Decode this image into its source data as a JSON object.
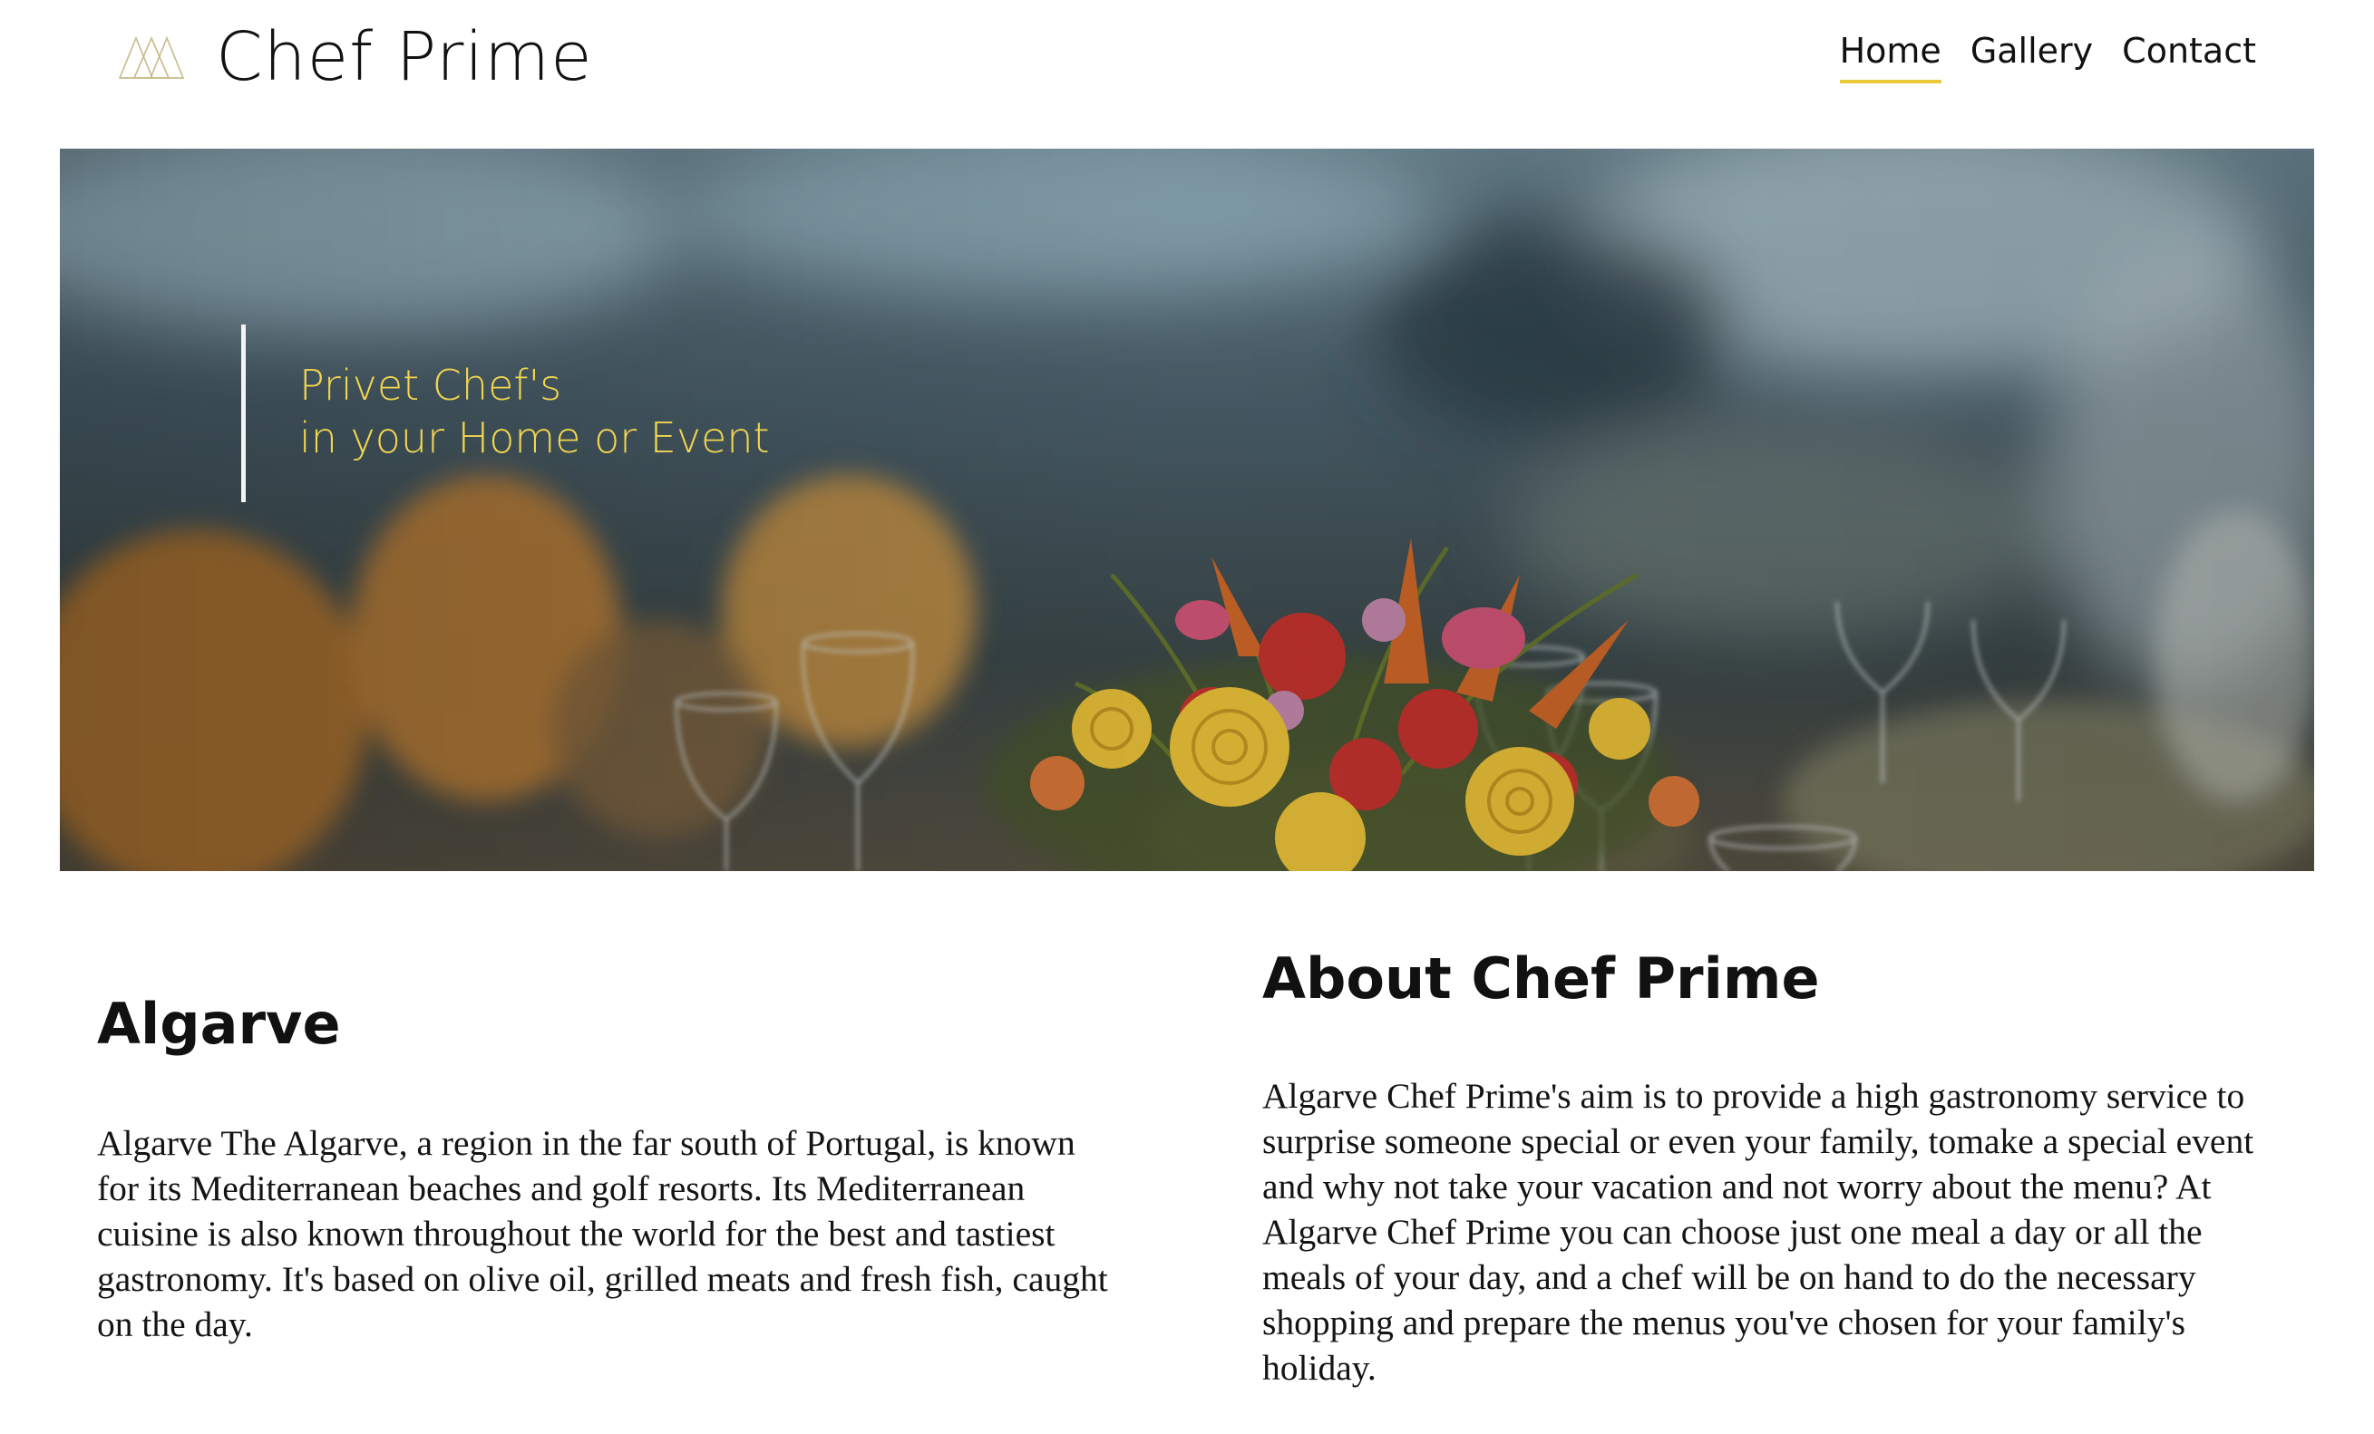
{
  "header": {
    "brand": "Chef Prime",
    "logo_icon": "triangles-logo-icon",
    "nav": [
      {
        "label": "Home",
        "active": true
      },
      {
        "label": "Gallery",
        "active": false
      },
      {
        "label": "Contact",
        "active": false
      }
    ]
  },
  "hero": {
    "tagline_line1": "Privet Chef's",
    "tagline_line2": "in your Home or Event",
    "image": "banquet-table-flowers-glasses"
  },
  "sections": {
    "left": {
      "title": "Algarve",
      "body": "Algarve The Algarve, a region in the far south of Portugal, is known for its Mediterranean beaches and golf resorts. Its Mediterranean cuisine is also known throughout the world for the best and tastiest gastronomy. It's based on olive oil, grilled meats and fresh fish, caught on the day."
    },
    "right": {
      "title": "About Chef Prime",
      "body": "Algarve Chef Prime's aim is to provide a high gastronomy service to surprise someone special or even your family, tomake a special event and why not take your vacation and not worry about the menu? At Algarve Chef Prime you can choose just one meal a day or all the meals of your day, and a chef will be on hand to do the necessary shopping and prepare the menus you've chosen for your family's holiday."
    }
  },
  "colors": {
    "accent": "#e9c83a",
    "tagline": "#f2d64f",
    "text": "#111111",
    "background": "#ffffff"
  }
}
